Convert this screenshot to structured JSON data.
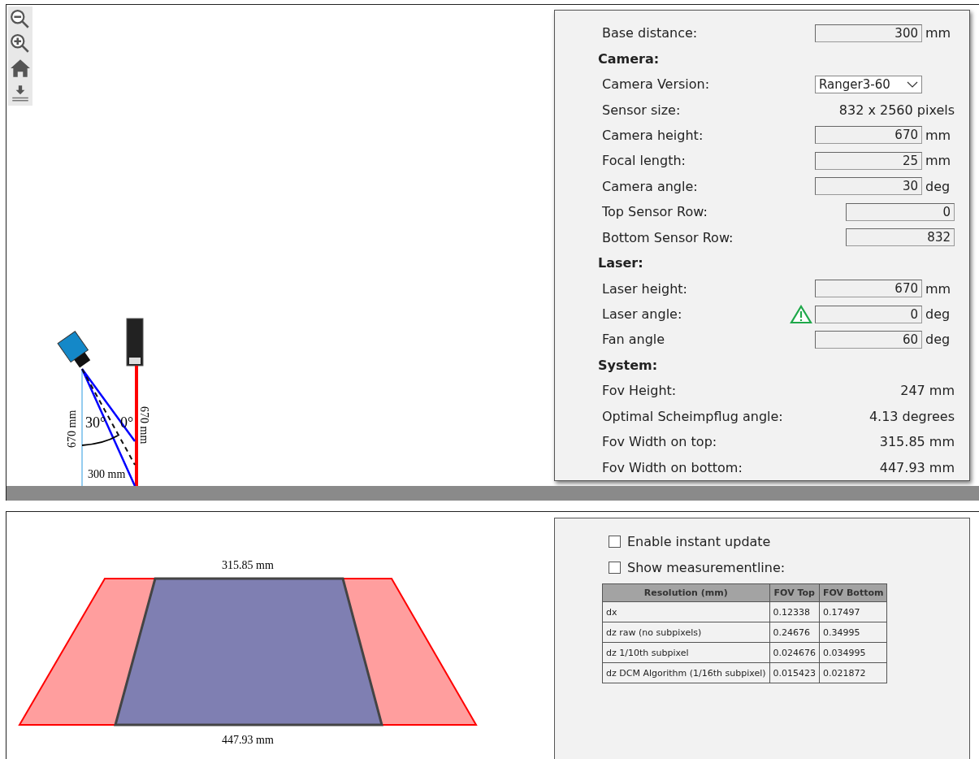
{
  "diagram": {
    "camera_height": "670 mm",
    "laser_height": "670 mm",
    "camera_angle": "30°",
    "laser_angle": "0°",
    "base_distance": "300 mm"
  },
  "settings": {
    "rows": [
      {
        "kind": "input",
        "label": "Base distance:",
        "value": "300",
        "unit": "mm",
        "warning": false
      },
      {
        "kind": "heading",
        "label": "Camera:"
      },
      {
        "kind": "select",
        "label": "Camera Version:",
        "value": "Ranger3-60"
      },
      {
        "kind": "readout",
        "label": "Sensor size:",
        "value": "832 x 2560 pixels"
      },
      {
        "kind": "input",
        "label": "Camera height:",
        "value": "670",
        "unit": "mm",
        "warning": false
      },
      {
        "kind": "input",
        "label": "Focal length:",
        "value": "25",
        "unit": "mm",
        "warning": false
      },
      {
        "kind": "input",
        "label": "Camera angle:",
        "value": "30",
        "unit": "deg",
        "warning": false
      },
      {
        "kind": "input",
        "label": "Top Sensor Row:",
        "value": "0",
        "warning": false
      },
      {
        "kind": "input",
        "label": "Bottom Sensor Row:",
        "value": "832",
        "warning": false
      },
      {
        "kind": "heading",
        "label": "Laser:"
      },
      {
        "kind": "input",
        "label": "Laser height:",
        "value": "670",
        "unit": "mm",
        "warning": false
      },
      {
        "kind": "input",
        "label": "Laser angle:",
        "value": "0",
        "unit": "deg",
        "warning": true
      },
      {
        "kind": "input",
        "label": "Fan angle",
        "value": "60",
        "unit": "deg",
        "warning": false
      },
      {
        "kind": "heading",
        "label": "System:"
      },
      {
        "kind": "readout",
        "label": "Fov Height:",
        "value": "247 mm"
      },
      {
        "kind": "readout",
        "label": "Optimal Scheimpflug angle:",
        "value": "4.13 degrees"
      },
      {
        "kind": "readout",
        "label": "Fov Width on top:",
        "value": "315.85 mm"
      },
      {
        "kind": "readout",
        "label": "Fov Width on bottom:",
        "value": "447.93 mm"
      }
    ]
  },
  "fov": {
    "top_width": "315.85 mm",
    "bottom_width": "447.93 mm"
  },
  "options": [
    {
      "label": "Enable instant update",
      "checked": false
    },
    {
      "label": "Show measurementline:",
      "checked": false
    }
  ],
  "table": {
    "columns": [
      "Resolution (mm)",
      "FOV Top",
      "FOV Bottom"
    ],
    "rows": [
      [
        "dx",
        "0.12338",
        "0.17497"
      ],
      [
        "dz raw (no subpixels)",
        "0.24676",
        "0.34995"
      ],
      [
        "dz 1/10th subpixel",
        "0.024676",
        "0.034995"
      ],
      [
        "dz DCM Algorithm (1/16th subpixel)",
        "0.015423",
        "0.021872"
      ]
    ]
  }
}
